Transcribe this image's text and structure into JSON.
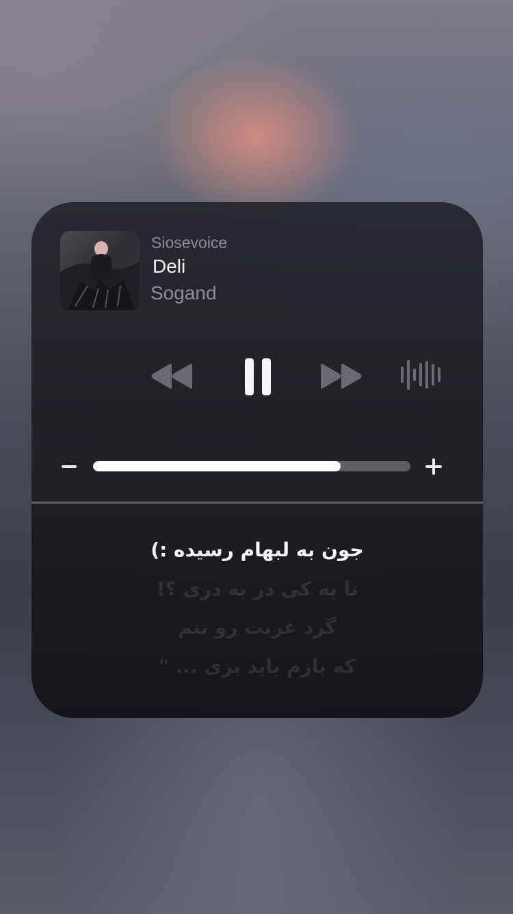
{
  "now_playing": {
    "source": "Siosevoice",
    "title": "Deli",
    "artist": "Sogand",
    "artwork_icon": "album-art"
  },
  "controls": {
    "rewind_icon": "rewind-icon",
    "pause_icon": "pause-icon",
    "forward_icon": "fast-forward-icon",
    "audio_output_icon": "waveform-icon",
    "state": "playing"
  },
  "volume": {
    "minus_label": "−",
    "plus_label": "+",
    "level": 0.78
  },
  "lyrics": {
    "lines": [
      "جون به لبهام رسیده :)",
      "تا به کی در به دری ؟!",
      "گرد غربت رو تنم",
      "که بازم باید بری ... \""
    ],
    "active_index": 0
  },
  "colors": {
    "widget_bg": "#24252c",
    "text_primary": "#f4f4f6",
    "text_secondary": "#8d8e96",
    "volume_fill": "#ffffff"
  }
}
